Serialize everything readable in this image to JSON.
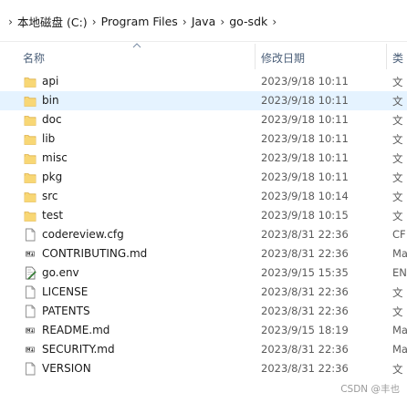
{
  "breadcrumb": {
    "items": [
      "本地磁盘 (C:)",
      "Program Files",
      "Java",
      "go-sdk"
    ],
    "separator": "›"
  },
  "columns": {
    "name": "名称",
    "date": "修改日期",
    "type": "类"
  },
  "files": [
    {
      "name": "api",
      "date": "2023/9/18 10:11",
      "type": "文",
      "icon": "folder-icon"
    },
    {
      "name": "bin",
      "date": "2023/9/18 10:11",
      "type": "文",
      "icon": "folder-icon",
      "selected": true
    },
    {
      "name": "doc",
      "date": "2023/9/18 10:11",
      "type": "文",
      "icon": "folder-icon"
    },
    {
      "name": "lib",
      "date": "2023/9/18 10:11",
      "type": "文",
      "icon": "folder-icon"
    },
    {
      "name": "misc",
      "date": "2023/9/18 10:11",
      "type": "文",
      "icon": "folder-icon"
    },
    {
      "name": "pkg",
      "date": "2023/9/18 10:11",
      "type": "文",
      "icon": "folder-icon"
    },
    {
      "name": "src",
      "date": "2023/9/18 10:14",
      "type": "文",
      "icon": "folder-icon"
    },
    {
      "name": "test",
      "date": "2023/9/18 10:15",
      "type": "文",
      "icon": "folder-icon"
    },
    {
      "name": "codereview.cfg",
      "date": "2023/8/31 22:36",
      "type": "CF",
      "icon": "file-icon"
    },
    {
      "name": "CONTRIBUTING.md",
      "date": "2023/8/31 22:36",
      "type": "Ma",
      "icon": "markdown-file-icon"
    },
    {
      "name": "go.env",
      "date": "2023/9/15 15:35",
      "type": "EN",
      "icon": "edited-file-icon"
    },
    {
      "name": "LICENSE",
      "date": "2023/8/31 22:36",
      "type": "文",
      "icon": "file-icon"
    },
    {
      "name": "PATENTS",
      "date": "2023/8/31 22:36",
      "type": "文",
      "icon": "file-icon"
    },
    {
      "name": "README.md",
      "date": "2023/9/15 18:19",
      "type": "Ma",
      "icon": "markdown-file-icon"
    },
    {
      "name": "SECURITY.md",
      "date": "2023/8/31 22:36",
      "type": "Ma",
      "icon": "markdown-file-icon"
    },
    {
      "name": "VERSION",
      "date": "2023/8/31 22:36",
      "type": "文",
      "icon": "file-icon"
    }
  ],
  "watermark": "CSDN @丰也",
  "colors": {
    "folder": "#f8d775",
    "folder_edge": "#dcb04a",
    "selection": "#e5f3ff",
    "header_text": "#4c607a"
  }
}
